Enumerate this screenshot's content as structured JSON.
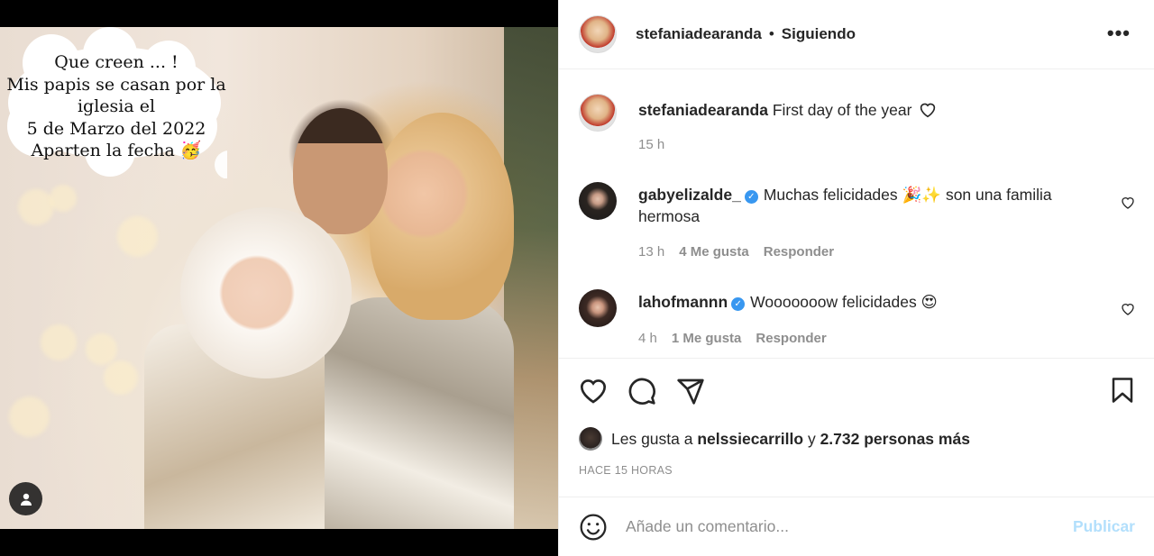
{
  "media": {
    "bubble_lines": [
      "Que creen ... !",
      "Mis papis se casan por la",
      "iglesia el",
      "5 de Marzo del 2022",
      "Aparten la fecha 🥳"
    ]
  },
  "header": {
    "username": "stefaniadearanda",
    "separator": "•",
    "follow_status": "Siguiendo",
    "more": "•••"
  },
  "caption": {
    "username": "stefaniadearanda",
    "text": "First day of the year",
    "time": "15 h"
  },
  "comments": [
    {
      "username": "gabyelizalde_",
      "verified": "✓",
      "text": "Muchas felicidades 🎉✨ son una familia hermosa",
      "time": "13 h",
      "likes": "4 Me gusta",
      "reply": "Responder"
    },
    {
      "username": "lahofmannn",
      "verified": "✓",
      "text": "Wooooooow felicidades 😍",
      "time": "4 h",
      "likes": "1 Me gusta",
      "reply": "Responder"
    }
  ],
  "likes": {
    "prefix": "Les gusta a",
    "user": "nelssiecarrillo",
    "conj": "y",
    "others": "2.732 personas más"
  },
  "timestamp": "HACE 15 HORAS",
  "composer": {
    "placeholder": "Añade un comentario...",
    "publish": "Publicar"
  },
  "icons": [
    "user-tag-icon",
    "more-icon",
    "heart-icon",
    "comment-icon",
    "share-icon",
    "bookmark-icon",
    "emoji-icon"
  ],
  "colors": {
    "link_disabled": "#b2dffc",
    "verified": "#3897f0",
    "muted": "#8e8e8e"
  }
}
